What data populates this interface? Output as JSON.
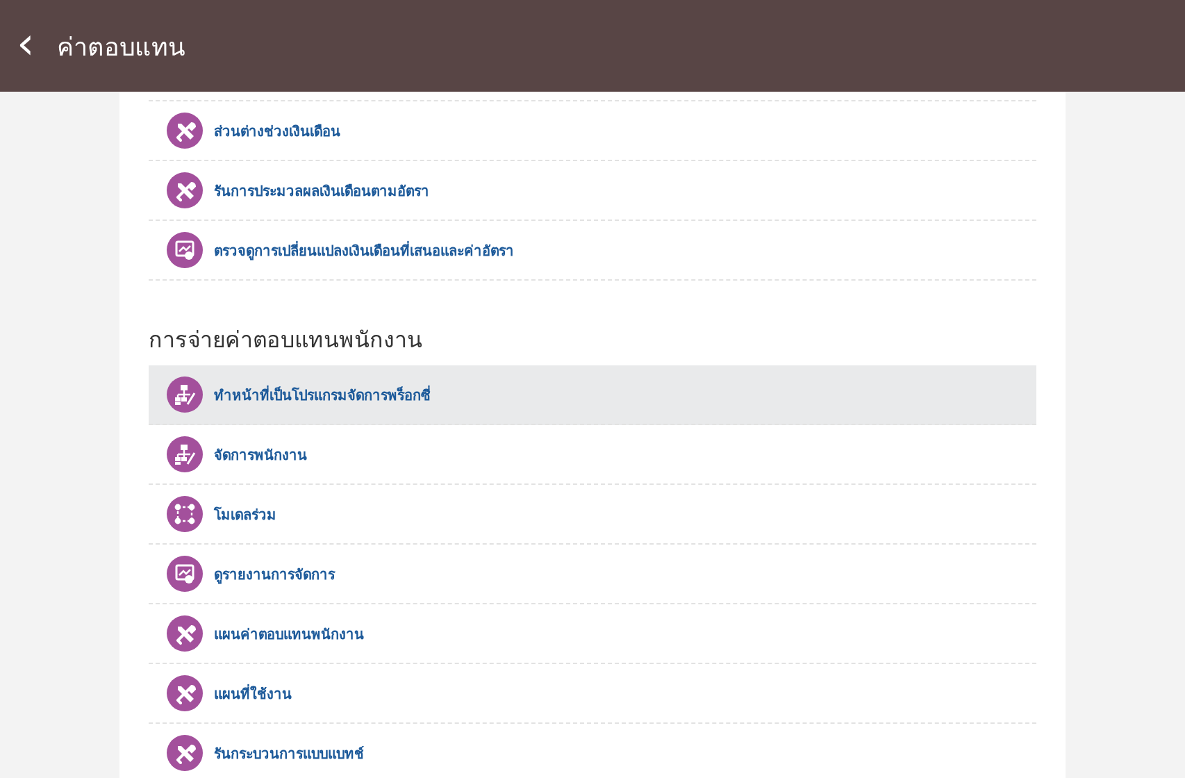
{
  "header": {
    "back_icon": "‹",
    "title": "ค่าตอบแทน"
  },
  "sections": [
    {
      "items": [
        {
          "label": "ส่วนต่างช่วงเงินเดือน",
          "kind": "tools",
          "selected": false
        },
        {
          "label": "รันการประมวลผลเงินเดือนตามอัตรา",
          "kind": "tools",
          "selected": false
        },
        {
          "label": "ตรวจดูการเปลี่ยนแปลงเงินเดือนที่เสนอและค่าอัตรา",
          "kind": "report",
          "selected": false
        }
      ]
    },
    {
      "heading": "การจ่ายค่าตอบแทนพนักงาน",
      "items": [
        {
          "label": "ทำหน้าที่เป็นโปรแกรมจัดการพร็อกซี่",
          "kind": "org",
          "selected": true
        },
        {
          "label": "จัดการพนักงาน",
          "kind": "org",
          "selected": false
        },
        {
          "label": "โมเดลร่วม",
          "kind": "model",
          "selected": false
        },
        {
          "label": "ดูรายงานการจัดการ",
          "kind": "report",
          "selected": false
        },
        {
          "label": "แผนค่าตอบแทนพนักงาน",
          "kind": "tools",
          "selected": false
        },
        {
          "label": "แผนที่ใช้งาน",
          "kind": "tools",
          "selected": false
        },
        {
          "label": "รันกระบวนการแบบแบทช์",
          "kind": "tools",
          "selected": false
        }
      ]
    }
  ]
}
